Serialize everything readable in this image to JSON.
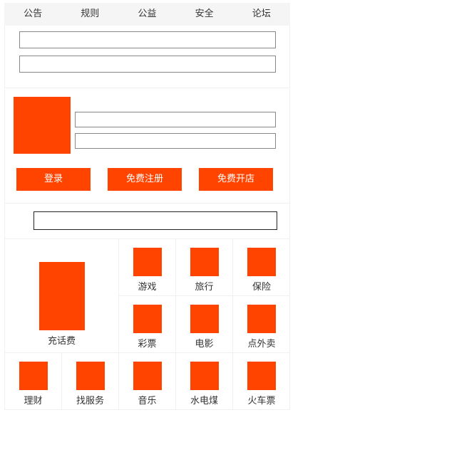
{
  "tabs": [
    "公告",
    "规则",
    "公益",
    "安全",
    "论坛"
  ],
  "login": {
    "login_label": "登录",
    "register_label": "免费注册",
    "open_shop_label": "免费开店"
  },
  "services": {
    "featured": "充话费",
    "row1": [
      "游戏",
      "旅行",
      "保险"
    ],
    "row2": [
      "彩票",
      "电影",
      "点外卖"
    ],
    "row3": [
      "理财",
      "找服务",
      "音乐",
      "水电煤",
      "火车票"
    ]
  },
  "colors": {
    "accent": "#ff4400"
  }
}
